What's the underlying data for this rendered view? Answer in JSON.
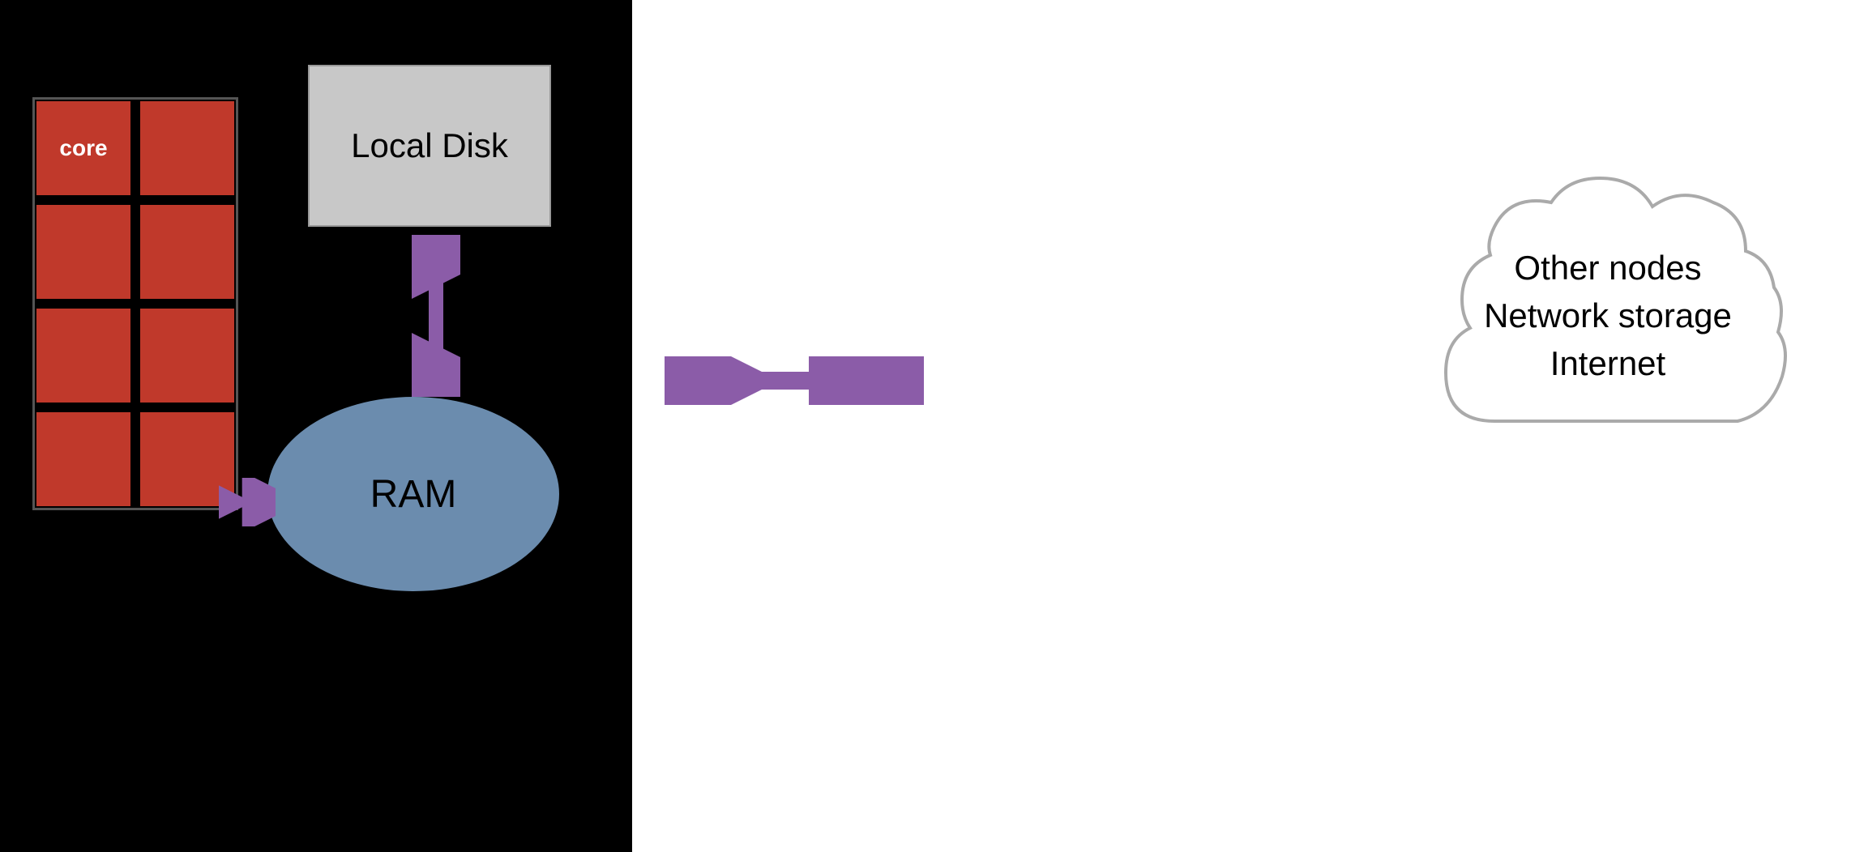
{
  "diagram": {
    "left_panel": {
      "background": "#000000",
      "cpu": {
        "label": "core",
        "grid_cols": 2,
        "grid_rows": 4,
        "cell_color": "#c0392b"
      },
      "local_disk": {
        "label": "Local Disk",
        "bg_color": "#c8c8c8"
      },
      "ram": {
        "label": "RAM",
        "bg_color": "#6b8cae"
      }
    },
    "right_panel": {
      "background": "#ffffff",
      "cloud": {
        "lines": [
          "Other nodes",
          "Network storage",
          "Internet"
        ]
      }
    },
    "arrow_color": "#8b5ca8"
  }
}
